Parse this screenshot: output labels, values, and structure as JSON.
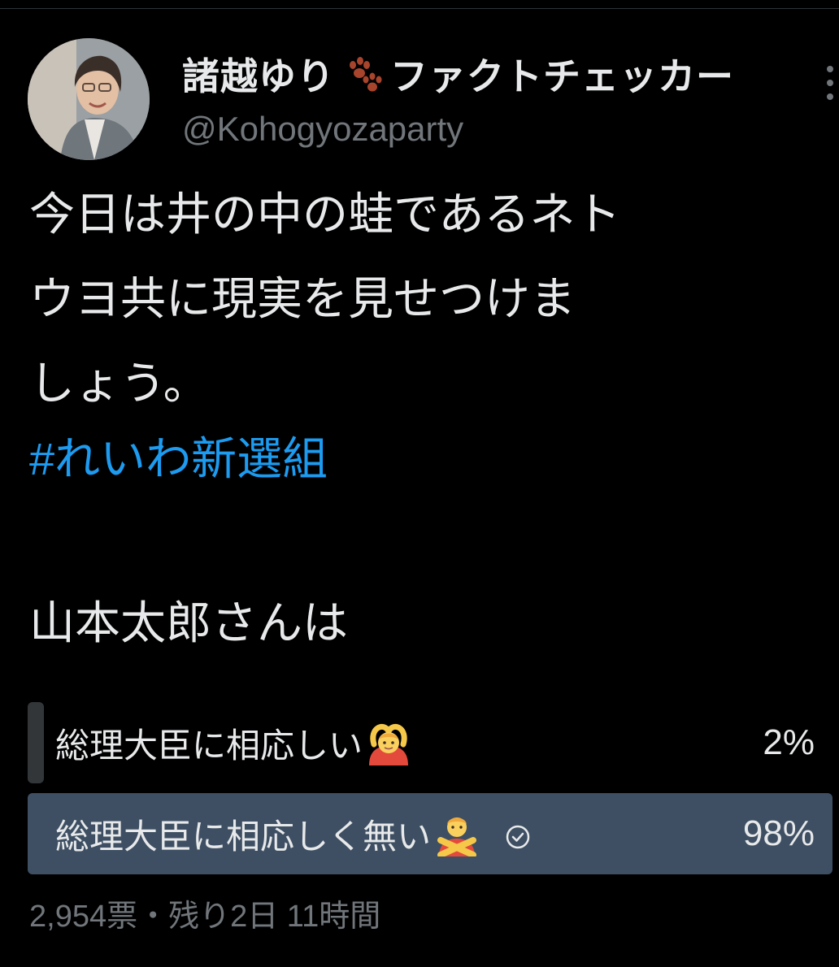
{
  "author": {
    "display_name": "諸越ゆり",
    "display_name_suffix": "ファクトチェッカー",
    "handle": "@Kohogyozaparty",
    "name_emoji": "paw-prints-icon"
  },
  "tweet": {
    "text": "今日は井の中の蛙であるネト\nウヨ共に現実を見せつけま\nしょう。",
    "hashtag": "#れいわ新選組",
    "question": "山本太郎さんは"
  },
  "poll": {
    "options": [
      {
        "label": "総理大臣に相応しい",
        "emoji": "person-gesturing-ok-icon",
        "percent_text": "2%",
        "percent": 2,
        "winner": false
      },
      {
        "label": "総理大臣に相応しく無い",
        "emoji": "person-gesturing-no-icon",
        "percent_text": "98%",
        "percent": 98,
        "winner": true,
        "selected_icon": "check-circle-icon"
      }
    ],
    "meta": "2,954票・残り2日 11時間"
  },
  "colors": {
    "background": "#000000",
    "text": "#e7e9ea",
    "muted": "#71767b",
    "link": "#1d9bf0",
    "poll_winner_fill": "#3e4f63",
    "poll_fill": "#333639"
  }
}
